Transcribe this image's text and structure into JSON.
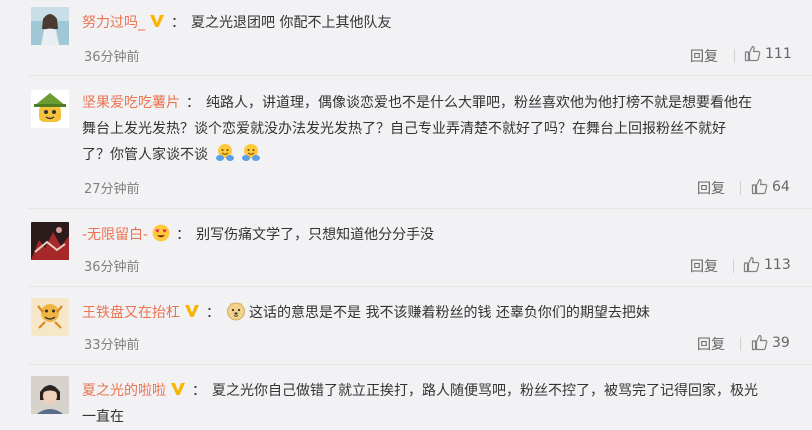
{
  "comments": [
    {
      "username": "努力过吗_",
      "badge": "vip",
      "text": "夏之光退团吧 你配不上其他队友",
      "time": "36分钟前",
      "reply_label": "回复",
      "likes": "111"
    },
    {
      "username": "坚果爱吃吃薯片",
      "badge": "",
      "text_lines": [
        "纯路人，讲道理，偶像谈恋爱也不是什么大罪吧，粉丝喜欢他为他打榜不就是想要看他在",
        "舞台上发光发热？谈个恋爱就没办法发光发热了？自己专业弄清楚不就好了吗？在舞台上回报粉丝不就好",
        "了？你管人家谈不谈"
      ],
      "time": "27分钟前",
      "reply_label": "回复",
      "likes": "64"
    },
    {
      "username": "-无限留白-",
      "badge": "heart",
      "text": "别写伤痛文学了，只想知道他分分手没",
      "time": "36分钟前",
      "reply_label": "回复",
      "likes": "113"
    },
    {
      "username": "王铁盘又在抬杠",
      "badge": "vip",
      "text": "这话的意思是不是 我不该赚着粉丝的钱 还辜负你们的期望去把妹",
      "time": "33分钟前",
      "reply_label": "回复",
      "likes": "39"
    },
    {
      "username": "夏之光的啦啦",
      "badge": "vip",
      "text_lines": [
        "夏之光你自己做错了就立正挨打，路人随便骂吧，粉丝不控了，被骂完了记得回家，极光",
        "一直在"
      ]
    }
  ],
  "colors": {
    "username": "#eb7350",
    "text": "#333333",
    "meta": "#808080",
    "background": "#f2f2f5",
    "vip_badge": "#f7b500"
  },
  "icons": {
    "like": "thumbs-up-icon",
    "vip": "vip-v-icon",
    "heart_badge": "heart-eyes-icon"
  }
}
